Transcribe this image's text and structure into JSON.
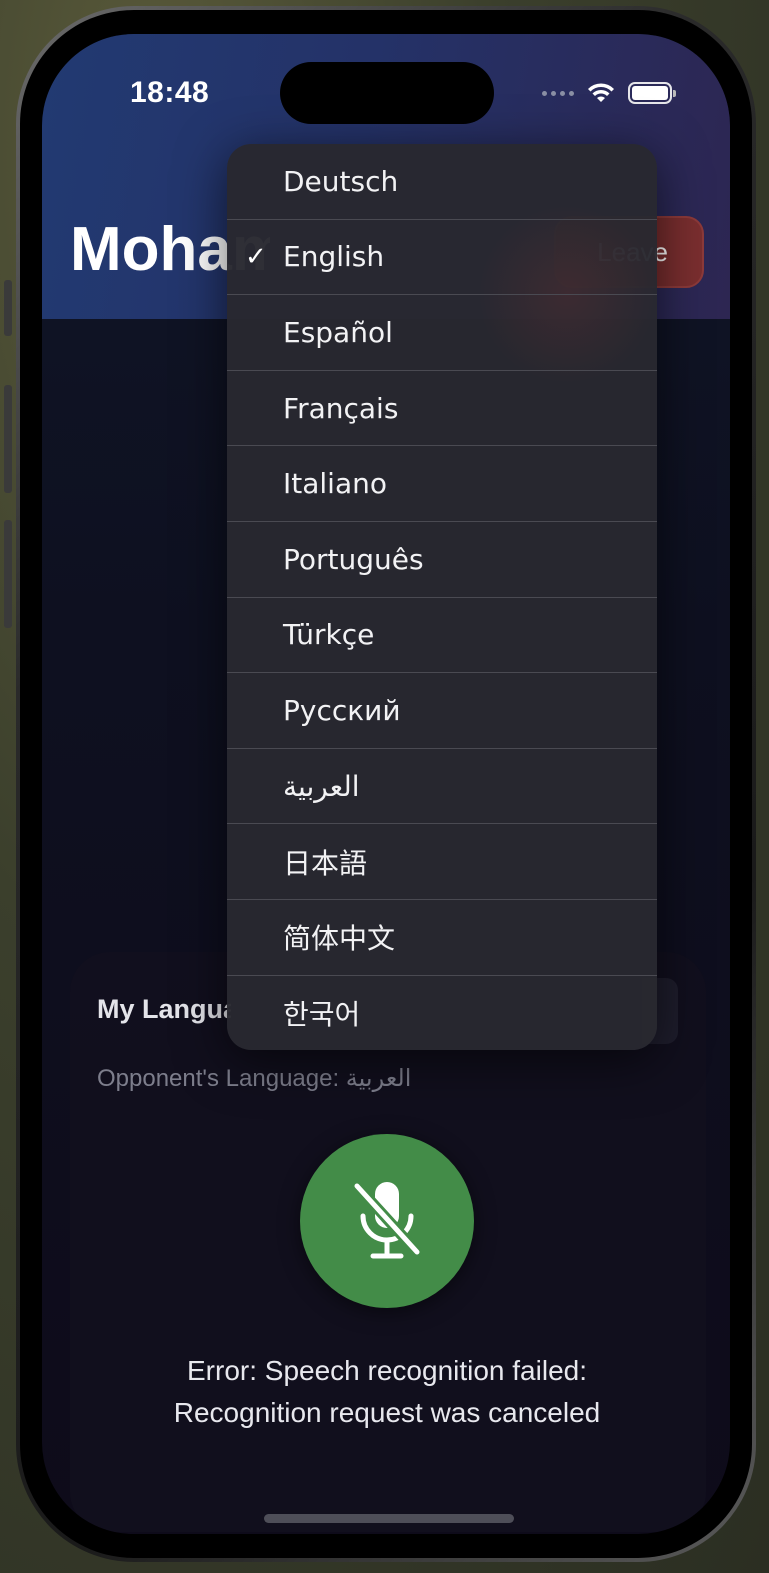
{
  "status": {
    "time": "18:48"
  },
  "header": {
    "title": "Mohammed",
    "button_label": "Leave"
  },
  "menu": {
    "selected": "English",
    "items": [
      {
        "label": "Deutsch",
        "checked": false
      },
      {
        "label": "English",
        "checked": true
      },
      {
        "label": "Español",
        "checked": false
      },
      {
        "label": "Français",
        "checked": false
      },
      {
        "label": "Italiano",
        "checked": false
      },
      {
        "label": "Português",
        "checked": false
      },
      {
        "label": "Türkçe",
        "checked": false
      },
      {
        "label": "Русский",
        "checked": false
      },
      {
        "label": "العربية",
        "checked": false
      },
      {
        "label": "日本語",
        "checked": false
      },
      {
        "label": "简体中文",
        "checked": false
      },
      {
        "label": "한국어",
        "checked": false
      }
    ]
  },
  "panel": {
    "my_language_label": "My Language",
    "opponent_language": "Opponent's Language: العربية"
  },
  "mic": {
    "state": "muted",
    "icon": "mic-slash-icon",
    "color": "#438c48"
  },
  "error": {
    "line1": "Error: Speech recognition failed:",
    "line2": "Recognition request was canceled"
  }
}
